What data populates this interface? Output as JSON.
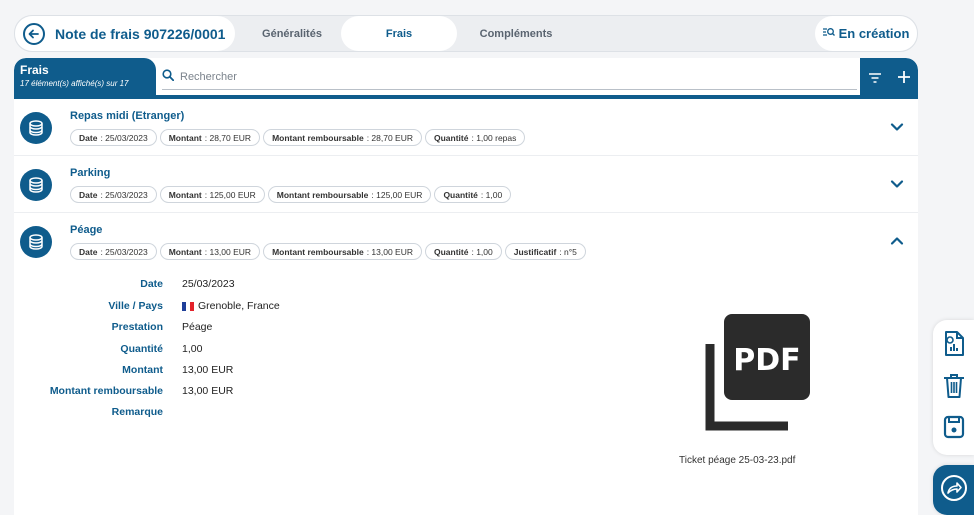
{
  "header": {
    "title": "Note de frais 907226/0001",
    "tabs": [
      {
        "label": "Généralités"
      },
      {
        "label": "Frais"
      },
      {
        "label": "Compléments"
      }
    ],
    "status": "En création"
  },
  "list": {
    "title": "Frais",
    "count_text": "17 élément(s) affiché(s) sur 17",
    "search_placeholder": "Rechercher"
  },
  "items": [
    {
      "title": "Repas midi (Etranger)",
      "chips": [
        {
          "label": "Date",
          "value": ": 25/03/2023"
        },
        {
          "label": "Montant",
          "value": ": 28,70 EUR"
        },
        {
          "label": "Montant remboursable",
          "value": ": 28,70 EUR"
        },
        {
          "label": "Quantité",
          "value": ": 1,00 repas"
        }
      ]
    },
    {
      "title": "Parking",
      "chips": [
        {
          "label": "Date",
          "value": ": 25/03/2023"
        },
        {
          "label": "Montant",
          "value": ": 125,00 EUR"
        },
        {
          "label": "Montant remboursable",
          "value": ": 125,00 EUR"
        },
        {
          "label": "Quantité",
          "value": ": 1,00"
        }
      ]
    },
    {
      "title": "Péage",
      "chips": [
        {
          "label": "Date",
          "value": ": 25/03/2023"
        },
        {
          "label": "Montant",
          "value": ": 13,00 EUR"
        },
        {
          "label": "Montant remboursable",
          "value": ": 13,00 EUR"
        },
        {
          "label": "Quantité",
          "value": ": 1,00"
        },
        {
          "label": "Justificatif",
          "value": ": n°5"
        }
      ]
    }
  ],
  "details": {
    "date_label": "Date",
    "date_value": "25/03/2023",
    "ville_label": "Ville / Pays",
    "ville_value": "Grenoble, France",
    "prestation_label": "Prestation",
    "prestation_value": "Péage",
    "quantite_label": "Quantité",
    "quantite_value": "1,00",
    "montant_label": "Montant",
    "montant_value": "13,00 EUR",
    "montant_remb_label": "Montant remboursable",
    "montant_remb_value": "13,00 EUR",
    "remarque_label": "Remarque",
    "remarque_value": "",
    "attachment_name": "Ticket péage 25-03-23.pdf",
    "attachment_icon_text": "PDF"
  },
  "colors": {
    "primary": "#0f5c8c"
  },
  "icons": [
    "back-arrow-icon",
    "search-icon",
    "filter-icon",
    "plus-icon",
    "coins-icon",
    "chevron-down-icon",
    "chevron-up-icon",
    "flag-france-icon",
    "pdf-file-icon",
    "report-file-icon",
    "trash-icon",
    "save-icon",
    "send-icon"
  ]
}
